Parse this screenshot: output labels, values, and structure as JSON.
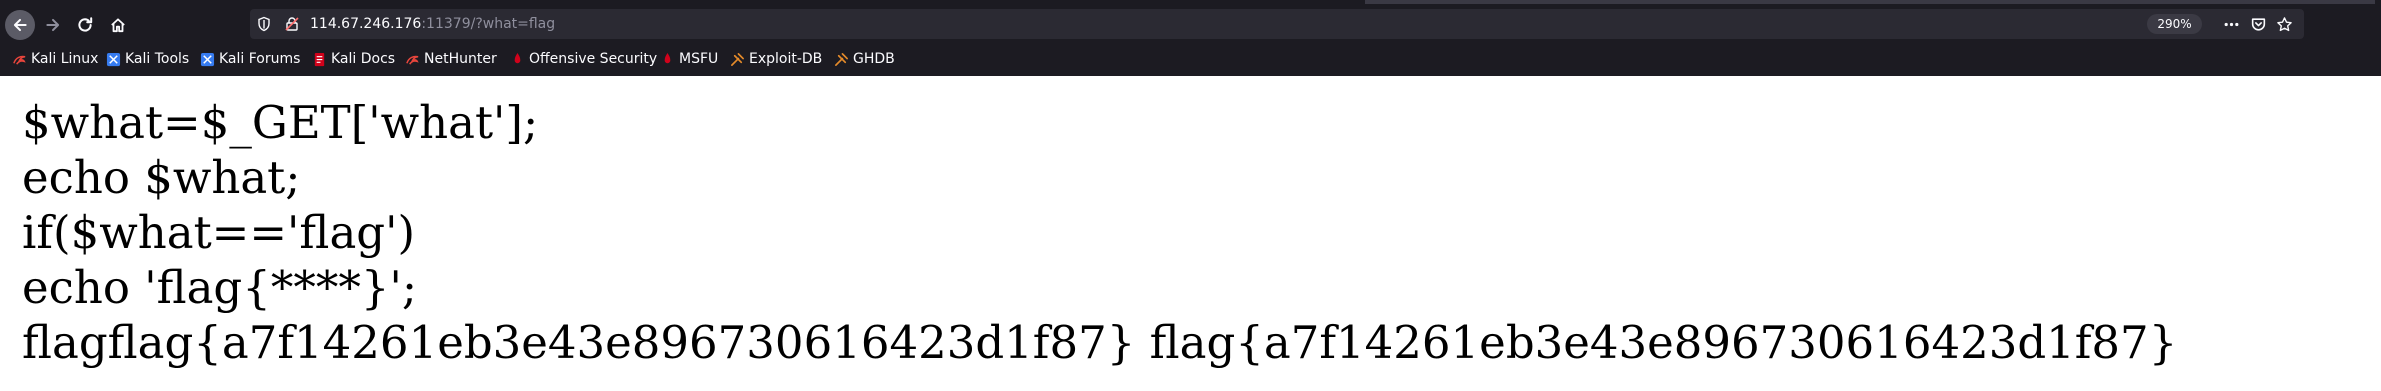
{
  "browser": {
    "url": {
      "host": "114.67.246.176",
      "rest": ":11379/?what=flag"
    },
    "zoom": "290%",
    "bookmarks": [
      {
        "label": "Kali Linux",
        "icon": "kali-dragon-icon"
      },
      {
        "label": "Kali Tools",
        "icon": "kali-tools-icon"
      },
      {
        "label": "Kali Forums",
        "icon": "kali-forums-icon"
      },
      {
        "label": "Kali Docs",
        "icon": "kali-docs-icon"
      },
      {
        "label": "NetHunter",
        "icon": "kali-dragon-icon"
      },
      {
        "label": "Offensive Security",
        "icon": "offsec-icon"
      },
      {
        "label": "MSFU",
        "icon": "offsec-icon"
      },
      {
        "label": "Exploit-DB",
        "icon": "exploit-db-icon"
      },
      {
        "label": "GHDB",
        "icon": "exploit-db-icon"
      }
    ]
  },
  "page": {
    "lines": [
      "$what=$_GET['what'];",
      "echo $what;",
      "if($what=='flag')",
      "echo 'flag{****}';",
      "flagflag{a7f14261eb3e43e896730616423d1f87} flag{a7f14261eb3e43e896730616423d1f87}"
    ]
  },
  "colors": {
    "chrome_bg": "#1c1b22",
    "urlbar_bg": "#2b2a33",
    "text_light": "#fbfbfe",
    "text_dim": "#8f8f9d",
    "kali_blue": "#367bf0",
    "offsec_red": "#d0021b",
    "exploitdb_orange": "#e58b2a"
  }
}
